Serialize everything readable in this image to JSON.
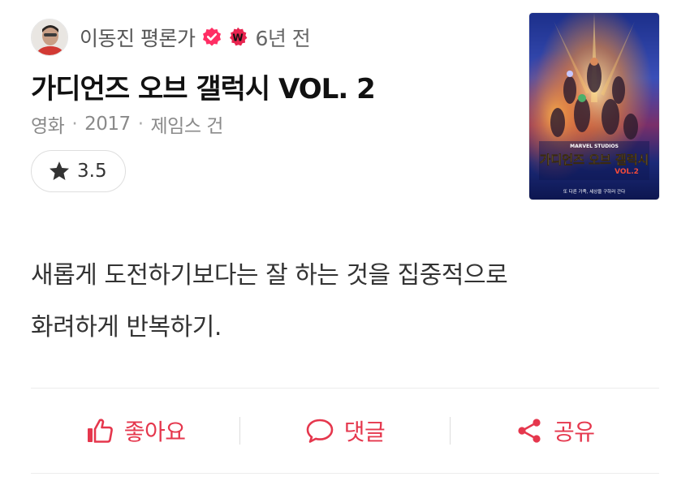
{
  "review": {
    "author_name": "이동진 평론가",
    "time_ago": "6년 전",
    "badge_letter": "W",
    "movie_title": "가디언즈 오브 갤럭시 VOL. 2",
    "category": "영화",
    "year": "2017",
    "director": "제임스 건",
    "meta_separator": "·",
    "rating": "3.5",
    "body_line_1": "새롭게 도전하기보다는 잘 하는 것을 집중적으로",
    "body_line_2": "화려하게 반복하기."
  },
  "poster": {
    "title_text": "가디언즈 오브 갤럭시",
    "vol_text": "VOL.2",
    "studio_text": "MARVEL STUDIOS",
    "tagline_text": "또 다른 가족, 세상을 구하러 간다"
  },
  "actions": {
    "like_label": "좋아요",
    "comment_label": "댓글",
    "share_label": "공유"
  },
  "colors": {
    "accent": "#e5374d",
    "verified": "#ff2e64",
    "badge": "#e8244f"
  }
}
